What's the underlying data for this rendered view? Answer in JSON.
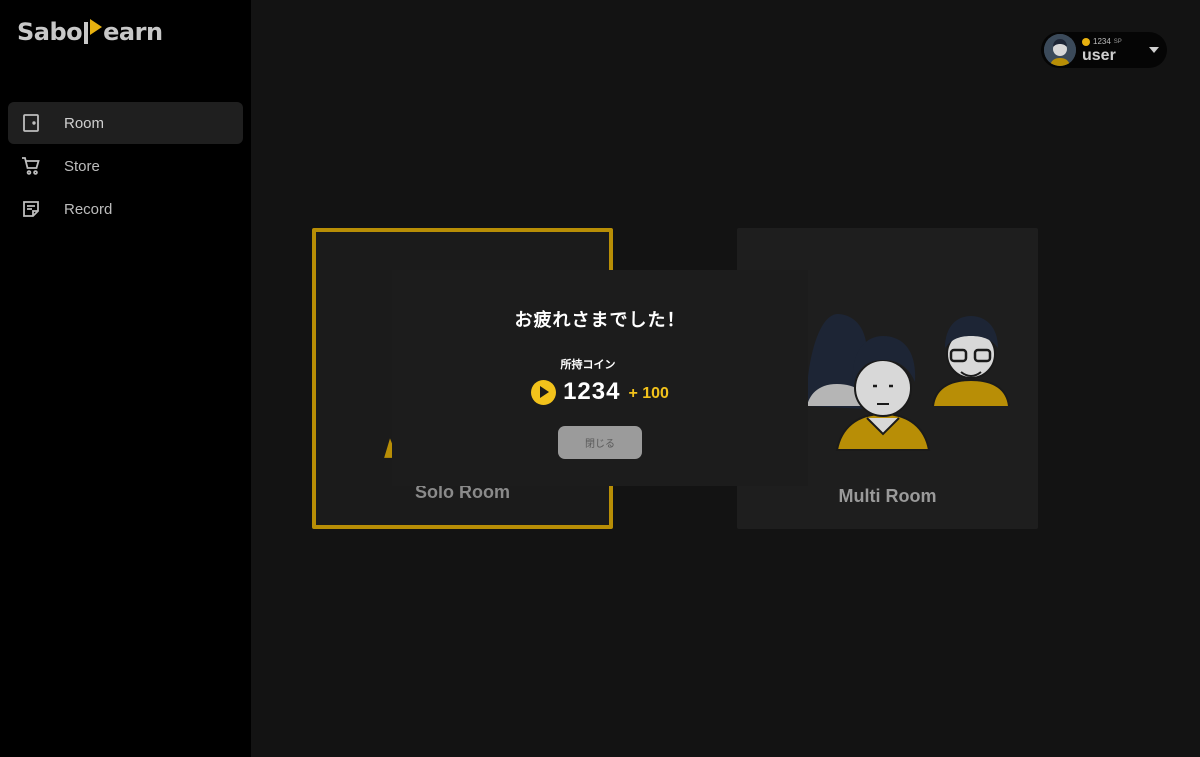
{
  "app": {
    "logo_prefix": "Sabo",
    "logo_suffix": "earn"
  },
  "sidebar": {
    "items": [
      {
        "label": "Room",
        "icon": "door-icon",
        "active": true
      },
      {
        "label": "Store",
        "icon": "cart-icon",
        "active": false
      },
      {
        "label": "Record",
        "icon": "note-icon",
        "active": false
      }
    ]
  },
  "user": {
    "sp": "1234",
    "sp_unit": "SP",
    "name": "user"
  },
  "rooms": {
    "solo_label": "Solo Room",
    "multi_label": "Multi Room"
  },
  "modal": {
    "title": "お疲れさまでした！",
    "coin_label": "所持コイン",
    "coin_value": "1234",
    "coin_gain": "+ 100",
    "close_label": "閉じる"
  },
  "colors": {
    "accent": "#e8b10f",
    "coin": "#f2c21b",
    "sidebar_bg": "#000000",
    "main_bg": "#131313"
  }
}
